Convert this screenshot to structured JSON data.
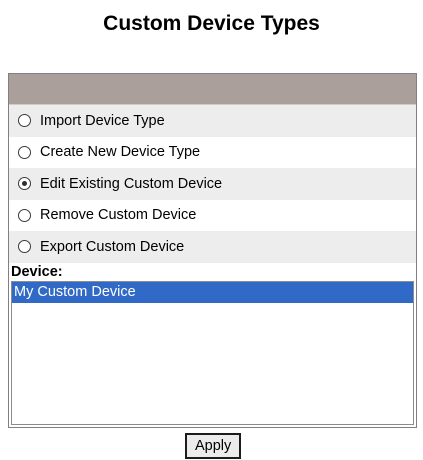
{
  "page": {
    "title": "Custom Device Types"
  },
  "actions": {
    "options": [
      {
        "label": "Import Device Type",
        "selected": false
      },
      {
        "label": "Create New Device Type",
        "selected": false
      },
      {
        "label": "Edit Existing Custom Device",
        "selected": true
      },
      {
        "label": "Remove Custom Device",
        "selected": false
      },
      {
        "label": "Export Custom Device",
        "selected": false
      }
    ]
  },
  "device": {
    "label": "Device:",
    "items": [
      "My Custom Device"
    ],
    "selected_index": 0
  },
  "apply": {
    "label": "Apply"
  },
  "colors": {
    "header_bar": "#ab9f9b",
    "row_alt": "#ededed",
    "selection": "#3169c6"
  }
}
